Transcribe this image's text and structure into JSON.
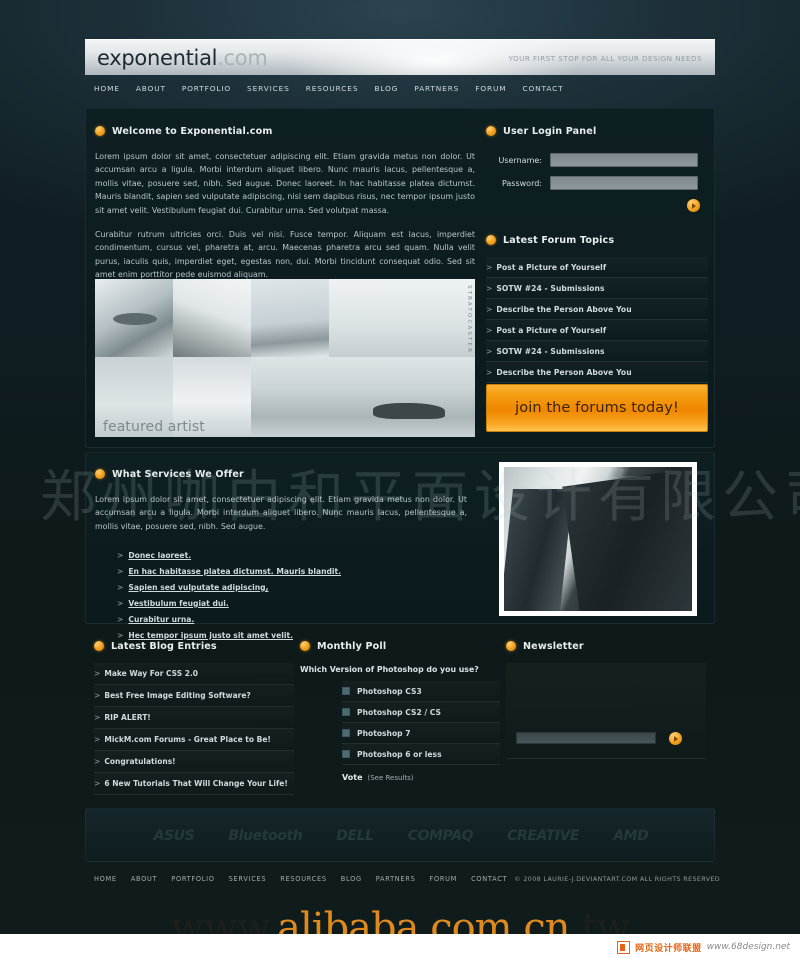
{
  "site": {
    "logo_main": "exponential",
    "logo_suffix": ".com",
    "tagline": "YOUR FIRST STOP FOR ALL YOUR DESIGN NEEDS"
  },
  "colors": {
    "accent": "#f5a623",
    "panel_bg": "#0e1f22",
    "page_bg": "#16262d",
    "text": "#b9c6ca",
    "heading": "#e8eef0"
  },
  "topnav": {
    "items": [
      {
        "label": "HOME"
      },
      {
        "label": "ABOUT"
      },
      {
        "label": "PORTFOLIO"
      },
      {
        "label": "SERVICES"
      },
      {
        "label": "RESOURCES"
      },
      {
        "label": "BLOG"
      },
      {
        "label": "PARTNERS"
      },
      {
        "label": "FORUM"
      },
      {
        "label": "CONTACT"
      }
    ]
  },
  "welcome": {
    "title": "Welcome to Exponential.com",
    "paragraph1": "Lorem ipsum dolor sit amet, consectetuer adipiscing elit. Etiam gravida metus non dolor. Ut accumsan arcu a ligula. Morbi interdum aliquet libero. Nunc mauris lacus, pellentesque a, mollis vitae, posuere sed, nibh. Sed augue. Donec laoreet. In hac habitasse platea dictumst. Mauris blandit, sapien sed vulputate adipiscing, nisl sem dapibus risus, nec tempor ipsum justo sit amet velit. Vestibulum feugiat dui. Curabitur urna. Sed volutpat massa.",
    "paragraph2": "Curabitur rutrum ultricies orci. Duis vel nisi. Fusce tempor. Aliquam est lacus, imperdiet condimentum, cursus vel, pharetra at, arcu. Maecenas pharetra arcu sed quam. Nulla velit purus, iaculis quis, imperdiet eget, egestas non, dui. Morbi tincidunt consequat odio. Sed sit amet enim porttitor pede euismod aliquam."
  },
  "featured": {
    "label": "featured artist",
    "vertical_label": "STRATOCASTER"
  },
  "login": {
    "title": "User Login Panel",
    "username_label": "Username:",
    "username_value": "",
    "username_placeholder": "",
    "password_label": "Password:",
    "password_value": "",
    "password_placeholder": "",
    "submit_icon": "arrow-right-icon"
  },
  "forum": {
    "title": "Latest Forum Topics",
    "topics": [
      {
        "label": "Post a Picture of Yourself"
      },
      {
        "label": "SOTW #24 - Submissions"
      },
      {
        "label": "Describe the Person Above You"
      },
      {
        "label": "Post a Picture of Yourself"
      },
      {
        "label": "SOTW #24 - Submissions"
      },
      {
        "label": "Describe the Person Above You"
      }
    ],
    "cta_label": "join the forums today!"
  },
  "services": {
    "title": "What Services We Offer",
    "paragraph": "Lorem ipsum dolor sit amet, consectetuer adipiscing elit. Etiam gravida metus non dolor. Ut accumsan arcu a ligula. Morbi interdum aliquet libero. Nunc mauris lacus, pellentesque a, mollis vitae, posuere sed, nibh. Sed augue.",
    "links": [
      {
        "label": "Donec laoreet."
      },
      {
        "label": "En hac habitasse platea dictumst. Mauris blandit."
      },
      {
        "label": "Sapien sed vulputate adipiscing,"
      },
      {
        "label": "Vestibulum feugiat dui."
      },
      {
        "label": "Curabitur urna."
      },
      {
        "label": "Hec tempor ipsum justo sit amet velit."
      }
    ]
  },
  "blog": {
    "title": "Latest Blog Entries",
    "entries": [
      {
        "label": "Make Way For CSS 2.0"
      },
      {
        "label": "Best Free Image Editing Software?"
      },
      {
        "label": "RIP ALERT!"
      },
      {
        "label": "MickM.com Forums - Great Place to Be!"
      },
      {
        "label": "Congratulations!"
      },
      {
        "label": "6 New Tutorials That Will Change Your Life!"
      }
    ]
  },
  "poll": {
    "title": "Monthly Poll",
    "question": "Which Version of Photoshop  do you use?",
    "options": [
      {
        "label": "Photoshop CS3"
      },
      {
        "label": "Photoshop CS2 / CS"
      },
      {
        "label": "Photoshop 7"
      },
      {
        "label": "Photoshop 6 or less"
      }
    ],
    "vote_label": "Vote",
    "results_label": "(See Results)"
  },
  "newsletter": {
    "title": "Newsletter",
    "input_value": "",
    "input_placeholder": "",
    "submit_icon": "arrow-right-icon"
  },
  "sponsors": {
    "items": [
      {
        "label": "ASUS"
      },
      {
        "label": "Bluetooth"
      },
      {
        "label": "DELL"
      },
      {
        "label": "COMPAQ"
      },
      {
        "label": "CREATIVE"
      },
      {
        "label": "AMD"
      }
    ]
  },
  "footer": {
    "nav": [
      {
        "label": "HOME"
      },
      {
        "label": "ABOUT"
      },
      {
        "label": "PORTFOLIO"
      },
      {
        "label": "SERVICES"
      },
      {
        "label": "RESOURCES"
      },
      {
        "label": "BLOG"
      },
      {
        "label": "PARTNERS"
      },
      {
        "label": "FORUM"
      },
      {
        "label": "CONTACT"
      }
    ],
    "copyright": "© 2008 LAURIE-J.DEVIANTART.COM ALL RIGHTS RESERVED"
  },
  "watermarks": {
    "cjk_overlay": "郑州咖由和平面设计有限公司",
    "alibaba_dark": "www.",
    "alibaba_orange": "alibaba.com.cn",
    "alibaba_tail": ".tw",
    "badge_cjk": "网页设计师联盟",
    "badge_url": "www.68design.net"
  }
}
